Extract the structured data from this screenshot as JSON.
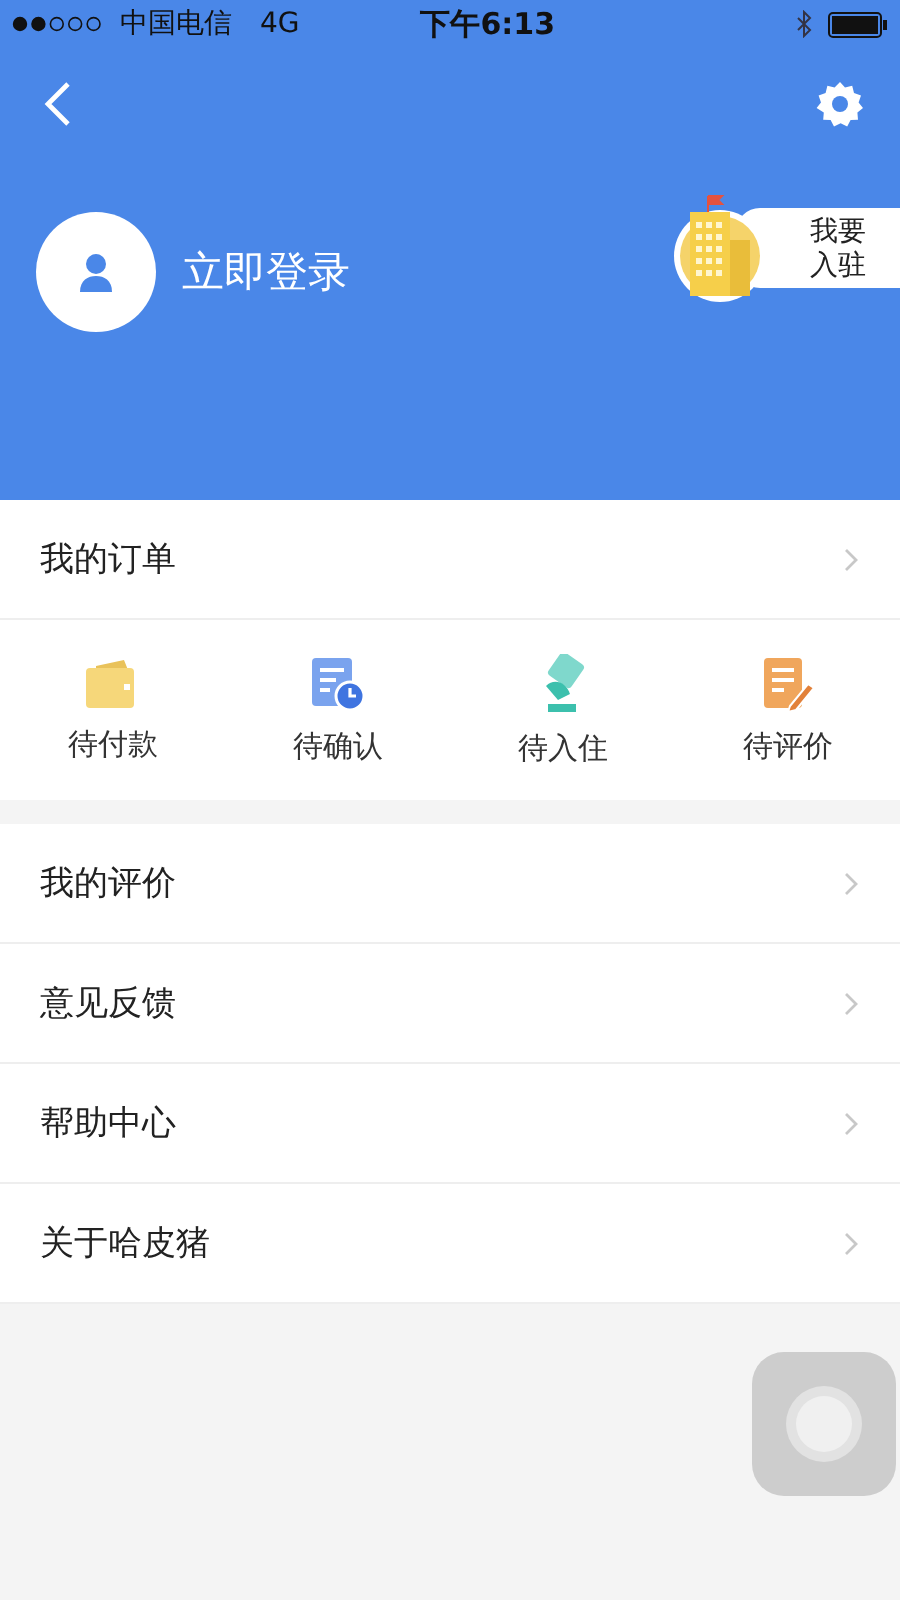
{
  "status_bar": {
    "carrier": "中国电信",
    "network": "4G",
    "time": "下午6:13"
  },
  "profile": {
    "login_label": "立即登录",
    "join_badge": {
      "lines": [
        "我要",
        "入驻"
      ]
    }
  },
  "orders": {
    "title": "我的订单",
    "statuses": [
      {
        "kind": "wallet",
        "label": "待付款"
      },
      {
        "kind": "clock",
        "label": "待确认"
      },
      {
        "kind": "stamp",
        "label": "待入住"
      },
      {
        "kind": "edit",
        "label": "待评价"
      }
    ]
  },
  "menu": [
    {
      "label": "我的评价"
    },
    {
      "label": "意见反馈"
    },
    {
      "label": "帮助中心"
    },
    {
      "label": "关于哈皮猪"
    }
  ]
}
